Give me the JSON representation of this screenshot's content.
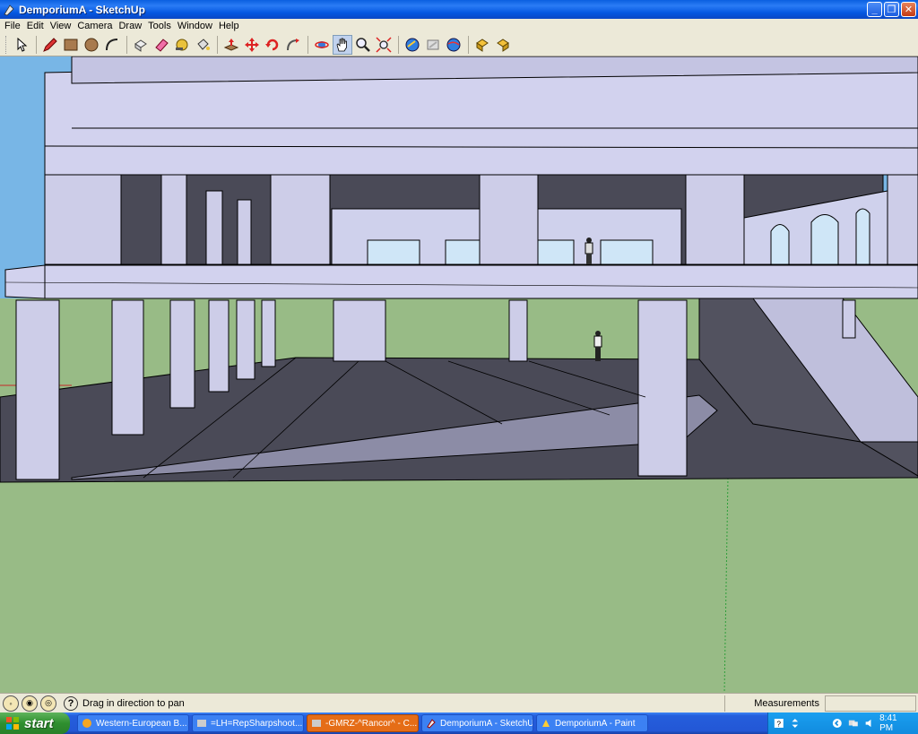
{
  "window": {
    "title": "DemporiumA - SketchUp"
  },
  "menu": [
    "File",
    "Edit",
    "View",
    "Camera",
    "Draw",
    "Tools",
    "Window",
    "Help"
  ],
  "toolbar": {
    "tools": [
      {
        "name": "select-tool"
      },
      {
        "name": "pencil-tool"
      },
      {
        "name": "rectangle-tool"
      },
      {
        "name": "circle-tool"
      },
      {
        "name": "arc-tool"
      },
      {
        "name": "make-component-tool"
      },
      {
        "name": "eraser-tool"
      },
      {
        "name": "tape-measure-tool"
      },
      {
        "name": "paint-bucket-tool"
      },
      {
        "name": "push-pull-tool"
      },
      {
        "name": "move-tool"
      },
      {
        "name": "rotate-tool"
      },
      {
        "name": "follow-me-tool"
      },
      {
        "name": "orbit-tool"
      },
      {
        "name": "pan-tool"
      },
      {
        "name": "zoom-tool"
      },
      {
        "name": "zoom-extents-tool"
      },
      {
        "name": "get-models-tool"
      },
      {
        "name": "share-model-tool"
      },
      {
        "name": "google-earth-tool"
      },
      {
        "name": "get-components-tool"
      },
      {
        "name": "share-component-tool"
      }
    ],
    "active_tool": "pan-tool"
  },
  "statusbar": {
    "hint": "Drag in direction to pan",
    "measurements_label": "Measurements",
    "measurements_value": ""
  },
  "taskbar": {
    "start_label": "start",
    "items": [
      {
        "label": "Western-European B...",
        "icon": "browser-icon",
        "active": false
      },
      {
        "label": "=LH=RepSharpshoot...",
        "icon": "game-icon",
        "active": false
      },
      {
        "label": "-GMRZ-^Rancor^ - C...",
        "icon": "game-icon",
        "active": true
      },
      {
        "label": "DemporiumA - SketchUp",
        "icon": "sketchup-icon",
        "active": false
      },
      {
        "label": "DemporiumA - Paint",
        "icon": "paint-icon",
        "active": false
      }
    ],
    "clock": "8:41 PM"
  },
  "colors": {
    "sky": "#78b6e6",
    "ground": "#98bb86",
    "face_light": "#cdcde8",
    "face_dark": "#4a4a57",
    "edge": "#000000"
  }
}
